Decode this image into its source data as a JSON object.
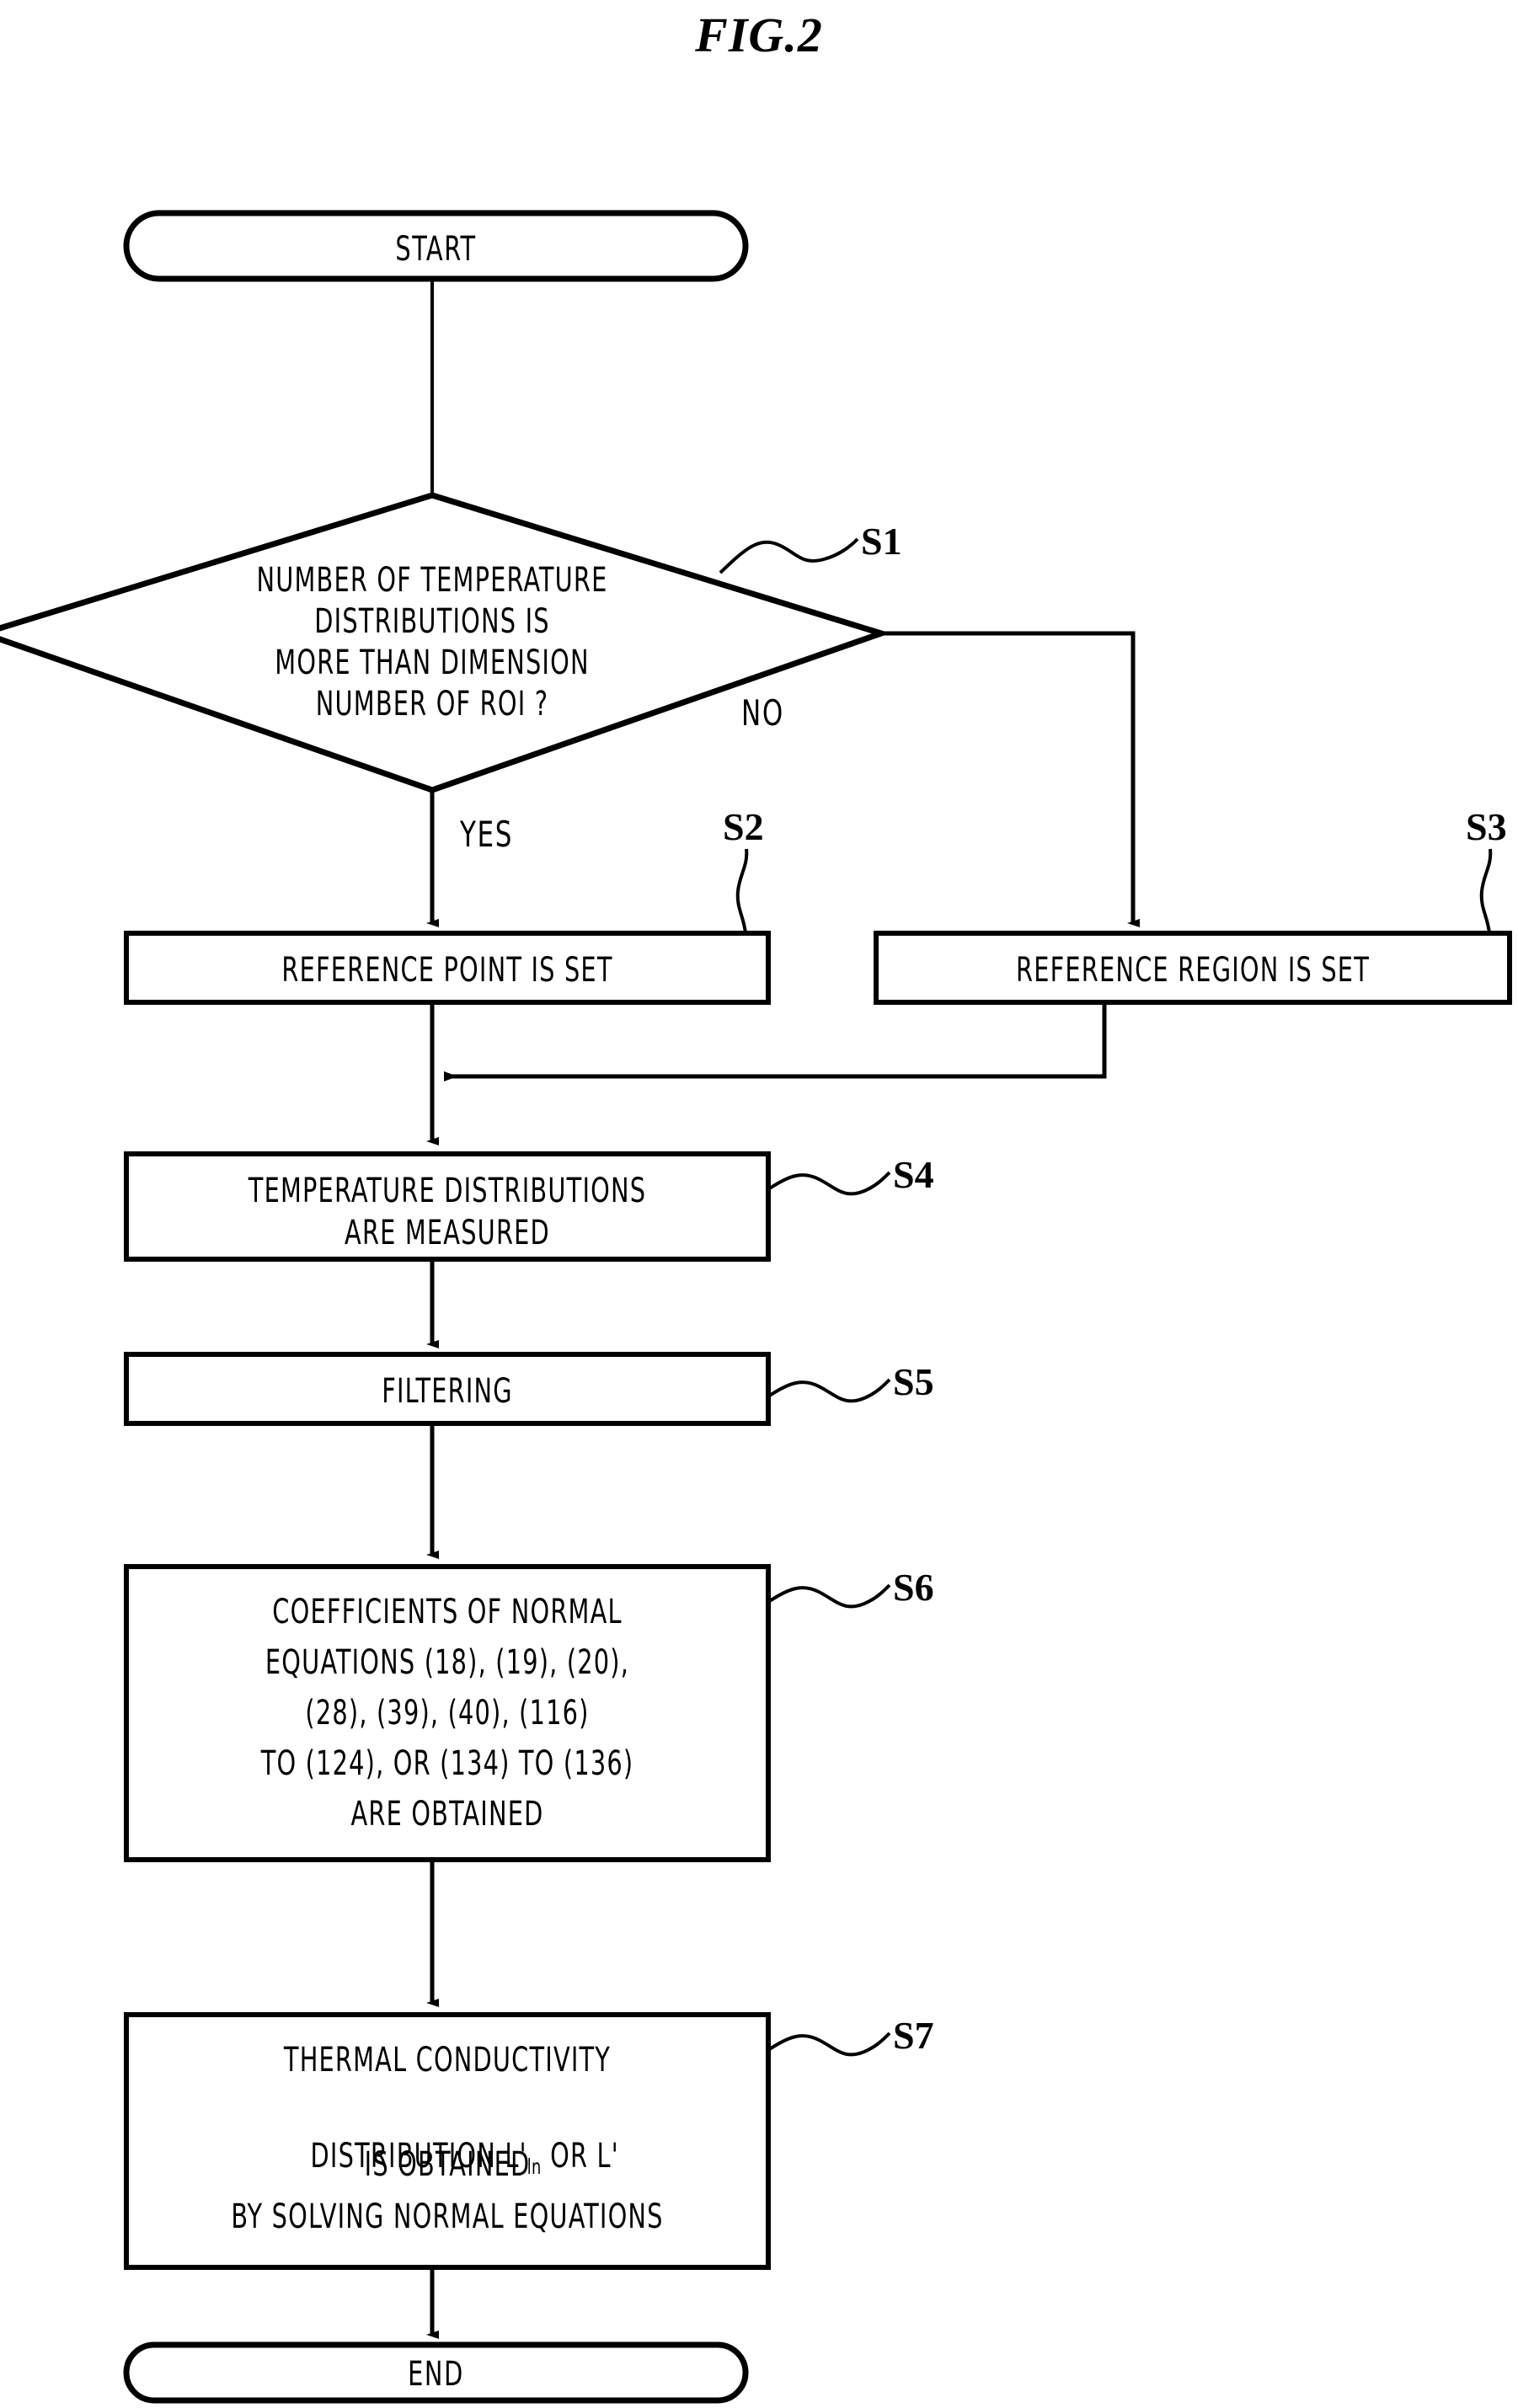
{
  "figure": {
    "title": "FIG.2",
    "type": "patent-flowchart",
    "stroke_color": "#000000",
    "background_color": "#ffffff"
  },
  "nodes": {
    "start": {
      "shape": "terminal",
      "label": "START"
    },
    "decision": {
      "shape": "diamond",
      "step": "S1",
      "line1": "NUMBER OF TEMPERATURE",
      "line2": "DISTRIBUTIONS IS",
      "line3": "MORE THAN DIMENSION",
      "line4": "NUMBER OF ROI ?",
      "yes_label": "YES",
      "no_label": "NO"
    },
    "s2": {
      "shape": "process",
      "step": "S2",
      "label": "REFERENCE POINT IS SET"
    },
    "s3": {
      "shape": "process",
      "step": "S3",
      "label": "REFERENCE REGION IS SET"
    },
    "s4": {
      "shape": "process",
      "step": "S4",
      "line1": "TEMPERATURE DISTRIBUTIONS",
      "line2": "ARE MEASURED"
    },
    "s5": {
      "shape": "process",
      "step": "S5",
      "label": "FILTERING"
    },
    "s6": {
      "shape": "process",
      "step": "S6",
      "line1": "COEFFICIENTS OF NORMAL",
      "line2": "EQUATIONS (18), (19), (20),",
      "line3": "(28), (39), (40), (116)",
      "line4": "TO (124), OR (134) TO (136)",
      "line5": "ARE OBTAINED"
    },
    "s7": {
      "shape": "process",
      "step": "S7",
      "line1": "THERMAL CONDUCTIVITY",
      "line2_a": "DISTRIBUTION L'",
      "line2_sub": "ln",
      "line2_b": " OR L'",
      "line3": "IS OBTAINED",
      "line4": "BY SOLVING NORMAL EQUATIONS"
    },
    "end": {
      "shape": "terminal",
      "label": "END"
    }
  }
}
